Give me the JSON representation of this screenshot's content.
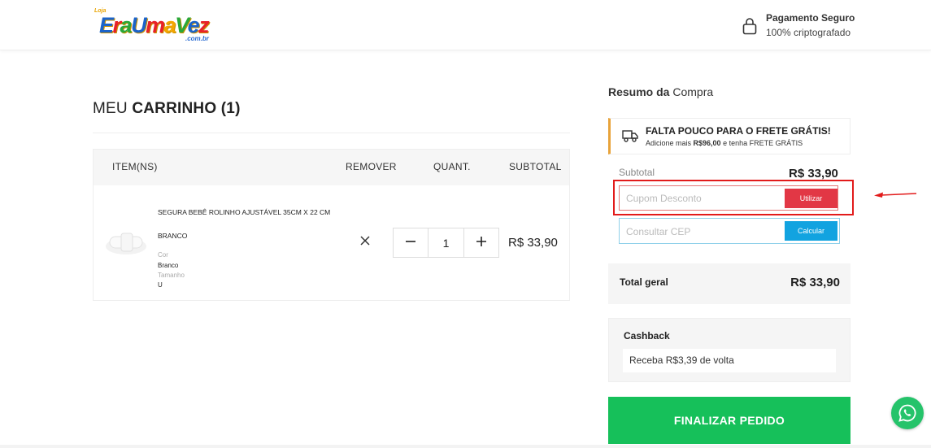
{
  "header": {
    "logo": {
      "prefix": "Loja",
      "word": "EraUmaVez",
      "domain": ".com.br"
    },
    "secure": {
      "title": "Pagamento Seguro",
      "subtitle": "100% criptografado",
      "icon": "lock-icon"
    }
  },
  "cart": {
    "title_prefix": "MEU ",
    "title_bold": "CARRINHO (1)",
    "columns": {
      "item": "ITEM(NS)",
      "remove": "REMOVER",
      "qty": "QUANT.",
      "subtotal": "SUBTOTAL"
    },
    "items": [
      {
        "name": "SEGURA BEBÊ ROLINHO AJUSTÁVEL 35CM X 22 CM",
        "variant": "BRANCO",
        "attr1_label": "Cor",
        "attr1_value": "Branco",
        "attr2_label": "Tamanho",
        "attr2_value": "U",
        "quantity": "1",
        "subtotal": "R$ 33,90"
      }
    ]
  },
  "summary": {
    "title_bold": "Resumo da",
    "title_rest": " Compra",
    "shipping": {
      "title": "FALTA POUCO PARA O FRETE GRÁTIS!",
      "sub_prefix": "Adicione mais ",
      "sub_amount": "R$96,00",
      "sub_suffix": " e tenha FRETE GRÁTIS",
      "icon": "truck-icon",
      "accent": "#e8a33a"
    },
    "subtotal_label": "Subtotal",
    "subtotal_value": "R$ 33,90",
    "coupon": {
      "placeholder": "Cupom Desconto",
      "button": "Utilizar",
      "button_color": "#e23745"
    },
    "cep": {
      "placeholder": "Consultar CEP",
      "button": "Calcular",
      "button_color": "#12a3e0"
    },
    "total_label": "Total geral",
    "total_value": "R$ 33,90",
    "cashback": {
      "title": "Cashback",
      "text": "Receba R$3,39 de volta"
    },
    "finish_button": "FINALIZAR PEDIDO",
    "finish_color": "#16c05a"
  },
  "whatsapp": {
    "icon": "whatsapp-icon",
    "color": "#25c36a"
  }
}
